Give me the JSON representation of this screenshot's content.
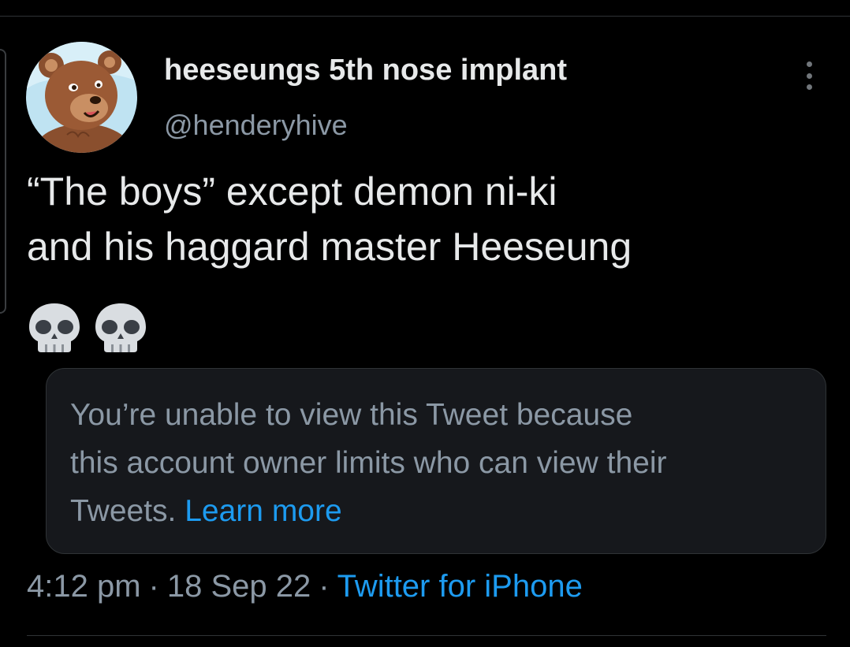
{
  "tweet": {
    "author": {
      "display_name": "heeseungs 5th nose implant",
      "handle": "@henderyhive",
      "avatar_icon": "bear-avatar"
    },
    "text_lines": [
      "“The boys” except demon ni-ki",
      "and his haggard master Heeseung"
    ],
    "emojis": [
      "skull-emoji",
      "skull-emoji"
    ],
    "quoted_tweet": {
      "notice_lines": [
        "You’re unable to view this Tweet because",
        "this account owner limits who can view their",
        "Tweets."
      ],
      "learn_more_label": "Learn more"
    },
    "time": "4:12 pm",
    "date": "18 Sep 22",
    "source": "Twitter for iPhone",
    "separator": "·"
  },
  "colors": {
    "background": "#000000",
    "text": "#e7e9ea",
    "secondary_text": "#8b98a5",
    "link": "#1d9bf0",
    "card_background": "#16181c",
    "border": "#2f3336"
  }
}
